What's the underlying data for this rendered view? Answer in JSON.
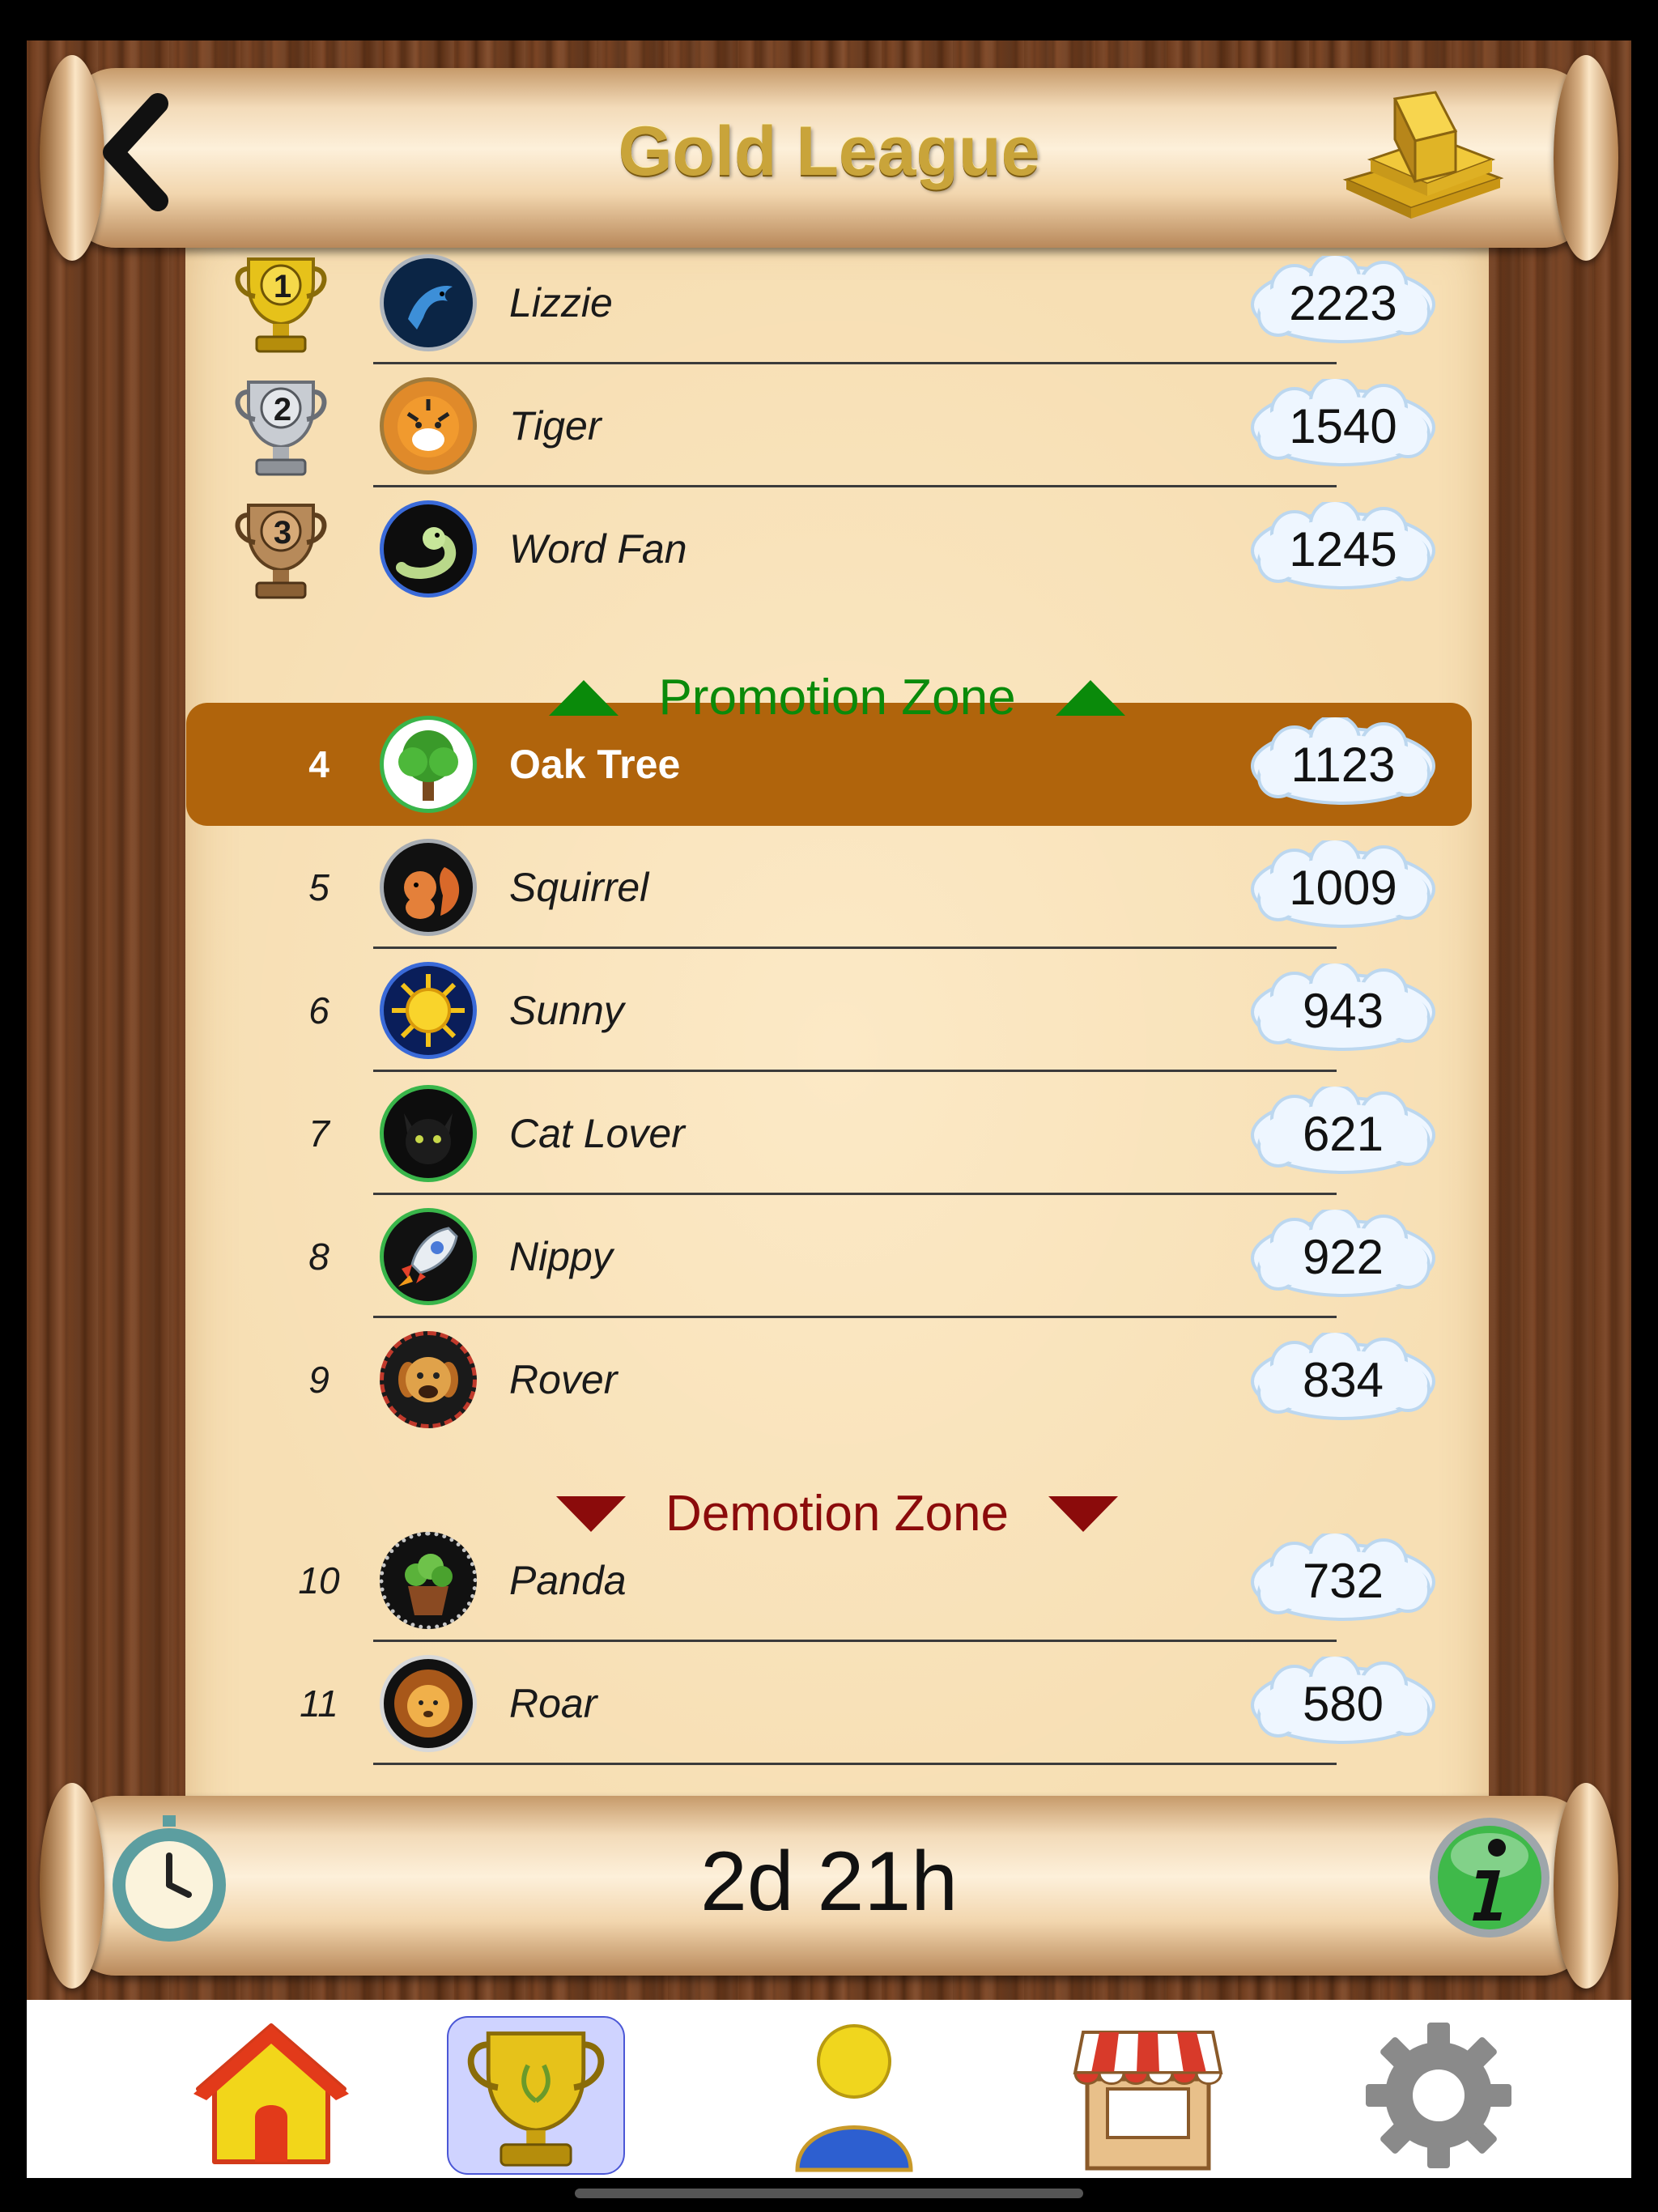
{
  "header": {
    "title": "Gold League"
  },
  "zones": {
    "promotion": "Promotion Zone",
    "demotion": "Demotion Zone"
  },
  "rows": [
    {
      "rank": "1",
      "name": "Lizzie",
      "score": "2223",
      "avatar": "dolphin-icon",
      "trophy": "gold"
    },
    {
      "rank": "2",
      "name": "Tiger",
      "score": "1540",
      "avatar": "tiger-icon",
      "trophy": "silver"
    },
    {
      "rank": "3",
      "name": "Word Fan",
      "score": "1245",
      "avatar": "worm-icon",
      "trophy": "bronze"
    },
    {
      "rank": "4",
      "name": "Oak Tree",
      "score": "1123",
      "avatar": "tree-icon",
      "highlighted": true
    },
    {
      "rank": "5",
      "name": "Squirrel",
      "score": "1009",
      "avatar": "squirrel-icon"
    },
    {
      "rank": "6",
      "name": "Sunny",
      "score": "943",
      "avatar": "sun-icon"
    },
    {
      "rank": "7",
      "name": "Cat Lover",
      "score": "621",
      "avatar": "cat-icon"
    },
    {
      "rank": "8",
      "name": "Nippy",
      "score": "922",
      "avatar": "rocket-icon"
    },
    {
      "rank": "9",
      "name": "Rover",
      "score": "834",
      "avatar": "dog-icon"
    },
    {
      "rank": "10",
      "name": "Panda",
      "score": "732",
      "avatar": "plant-icon"
    },
    {
      "rank": "11",
      "name": "Roar",
      "score": "580",
      "avatar": "lion-icon"
    }
  ],
  "footer": {
    "timer": "2d 21h"
  },
  "tabs": [
    {
      "name": "home",
      "icon": "house-icon"
    },
    {
      "name": "leagues",
      "icon": "trophy-icon",
      "selected": true
    },
    {
      "name": "profile",
      "icon": "person-icon"
    },
    {
      "name": "shop",
      "icon": "shop-icon"
    },
    {
      "name": "settings",
      "icon": "gear-icon"
    }
  ],
  "colors": {
    "highlight": "#b0640c",
    "promotion": "#0a8a0a",
    "demotion": "#8b0b0b",
    "title_gold": "#c9a43a"
  }
}
